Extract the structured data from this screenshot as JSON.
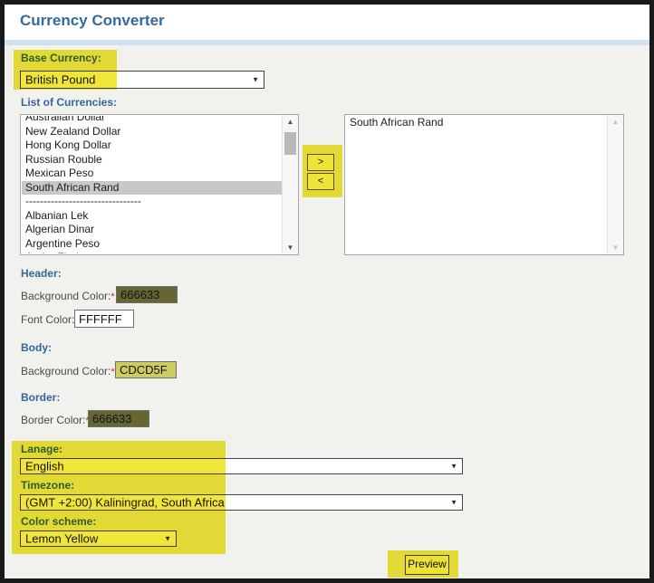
{
  "window": {
    "title": "Currency Converter"
  },
  "icons": {
    "dropdown_caret": "▼",
    "scroll_up": "▲",
    "scroll_down": "▼"
  },
  "colors": {
    "highlight": "#f0e63a",
    "accent_blue": "#33679b",
    "selected_row": "#c8c8c8"
  },
  "base_currency": {
    "label": "Base Currency:",
    "value": "British Pound"
  },
  "currency_list": {
    "label": "List of Currencies:",
    "available": [
      "Australian Dollar",
      "New Zealand Dollar",
      "Hong Kong Dollar",
      "Russian Rouble",
      "Mexican Peso",
      "South African Rand",
      "--------------------------------",
      "Albanian Lek",
      "Algerian Dinar",
      "Argentine Peso",
      "Aruba Florin"
    ],
    "selected_index": 5,
    "move_right": ">",
    "move_left": "<",
    "chosen": [
      "South African Rand"
    ]
  },
  "header_section": {
    "title": "Header:",
    "background_color": {
      "label": "Background Color:",
      "required": "*",
      "value": "666633",
      "bg": "#666633"
    },
    "font_color": {
      "label": "Font Color:",
      "required": "*",
      "value": "FFFFFF",
      "bg": "#FFFFFF"
    }
  },
  "body_section": {
    "title": "Body:",
    "background_color": {
      "label": "Background Color:",
      "required": "*",
      "value": "CDCD5F",
      "bg": "#CDCD5F"
    }
  },
  "border_section": {
    "title": "Border:",
    "border_color": {
      "label": "Border Color:",
      "required": "*",
      "value": "666633",
      "bg": "#666633"
    }
  },
  "language": {
    "label": "Lanage:",
    "value": "English"
  },
  "timezone": {
    "label": "Timezone:",
    "value": "(GMT +2:00) Kaliningrad, South Africa"
  },
  "color_scheme": {
    "label": "Color scheme:",
    "value": "Lemon Yellow"
  },
  "preview": {
    "label": "Preview"
  }
}
